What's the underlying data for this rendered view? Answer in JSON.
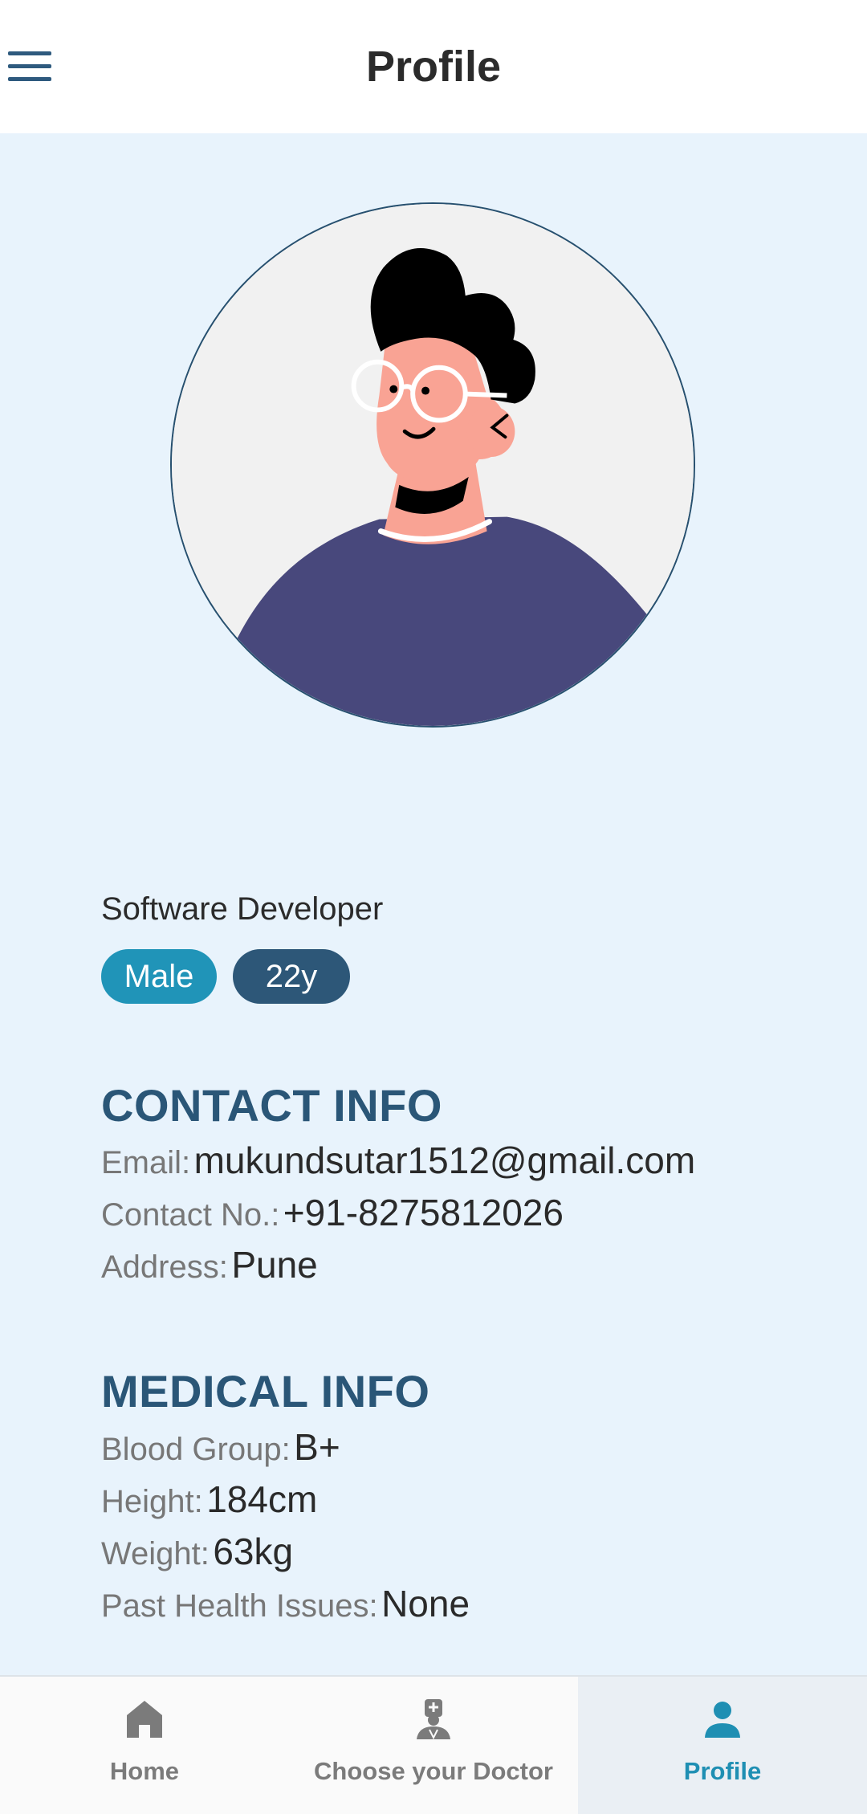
{
  "header": {
    "title": "Profile",
    "menu_icon": "hamburger-menu-icon"
  },
  "profile": {
    "occupation": "Software Developer",
    "gender": "Male",
    "age": "22y",
    "badge_colors": {
      "gender": "#2094b8",
      "age": "#2d5778"
    }
  },
  "contact": {
    "title": "CONTACT INFO",
    "email_label": "Email:",
    "email": "mukundsutar1512@gmail.com",
    "phone_label": "Contact No.:",
    "phone": "+91-8275812026",
    "address_label": "Address:",
    "address": "Pune"
  },
  "medical": {
    "title": "MEDICAL INFO",
    "blood_label": "Blood Group:",
    "blood": "B+",
    "height_label": "Height:",
    "height": "184cm",
    "weight_label": "Weight:",
    "weight": "63kg",
    "issues_label": "Past Health Issues:",
    "issues": "None"
  },
  "nav": {
    "items": [
      {
        "label": "Home",
        "icon": "home-icon",
        "active": false
      },
      {
        "label": "Choose your Doctor",
        "icon": "doctor-icon",
        "active": false
      },
      {
        "label": "Profile",
        "icon": "person-icon",
        "active": true
      }
    ],
    "active_color": "#1f8fb3",
    "inactive_color": "#7b7b7b"
  },
  "colors": {
    "background": "#e8f3fc",
    "accent": "#2a5677"
  }
}
